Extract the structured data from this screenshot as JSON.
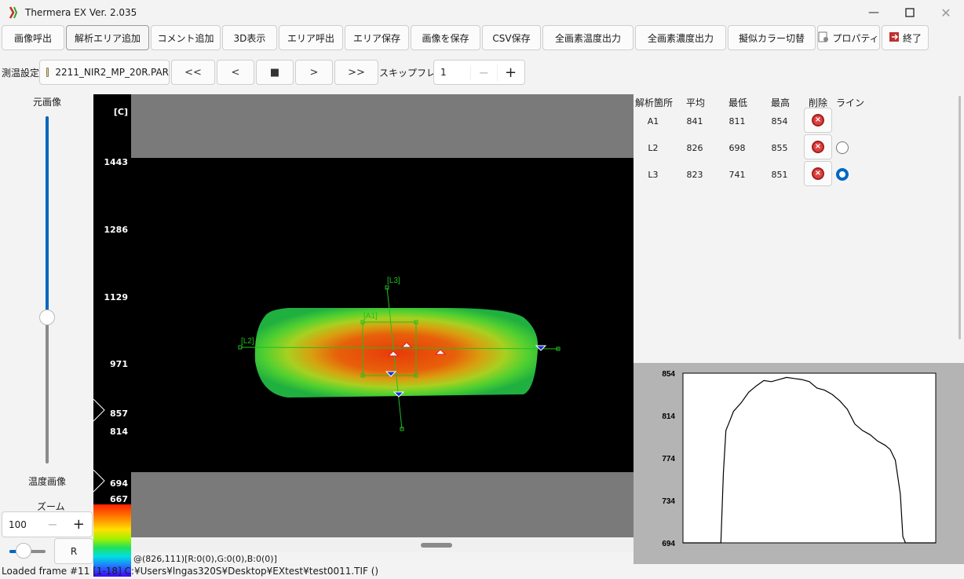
{
  "app": {
    "title": "Thermera EX Ver. 2.035"
  },
  "toolbar": {
    "buttons": [
      {
        "label": "画像呼出"
      },
      {
        "label": "解析エリア追加"
      },
      {
        "label": "コメント追加"
      },
      {
        "label": "3D表示"
      },
      {
        "label": "エリア呼出"
      },
      {
        "label": "エリア保存"
      },
      {
        "label": "画像を保存"
      },
      {
        "label": "CSV保存"
      },
      {
        "label": "全画素温度出力"
      },
      {
        "label": "全画素濃度出力"
      },
      {
        "label": "擬似カラー切替"
      },
      {
        "label": "プロパティ"
      },
      {
        "label": "終了"
      }
    ]
  },
  "measure": {
    "label": "測温設定",
    "file": "2211_NIR2_MP_20R.PAR",
    "nav": [
      "<<",
      "<",
      "■",
      ">",
      ">>"
    ],
    "skip_label": "スキップフレーム",
    "skip_value": "1",
    "minus": "−",
    "plus": "+"
  },
  "left": {
    "original_label": "元画像",
    "thermal_label": "温度画像",
    "original_vs_thermal_slider": 0.58,
    "zoom_label": "ズーム",
    "zoom_value": "100",
    "minus": "−",
    "plus": "+",
    "zoom_slider": 0.4,
    "r_label": "R"
  },
  "scale": {
    "header": "[C]",
    "ticks": [
      "1443",
      "1286",
      "1129",
      "971",
      "857",
      "814",
      "694",
      "667"
    ]
  },
  "image": {
    "areas": [
      "[L3]",
      "[A1]",
      "[L2]"
    ],
    "coord_readout": "@(826,111)[R:0(0),G:0(0),B:0(0)]"
  },
  "results": {
    "headers": [
      "解析箇所",
      "平均",
      "最低",
      "最高",
      "削除",
      "ライン"
    ],
    "rows": [
      {
        "name": "A1",
        "avg": "841",
        "min": "811",
        "max": "854",
        "line": null
      },
      {
        "name": "L2",
        "avg": "826",
        "min": "698",
        "max": "855",
        "line": false
      },
      {
        "name": "L3",
        "avg": "823",
        "min": "741",
        "max": "851",
        "line": true
      }
    ]
  },
  "chart_data": {
    "type": "line",
    "yticks": [
      "854",
      "814",
      "774",
      "734",
      "694"
    ],
    "ylim": [
      694,
      854
    ],
    "xlim": [
      0,
      100
    ],
    "x": [
      0,
      15,
      16,
      17,
      18,
      20,
      23,
      26,
      29,
      32,
      35,
      38,
      41,
      44,
      47,
      50,
      53,
      56,
      59,
      62,
      65,
      68,
      71,
      74,
      77,
      80,
      82,
      84,
      86,
      87,
      88,
      100
    ],
    "series": [
      {
        "values": [
          694,
          694,
          760,
          800,
          806,
          818,
          826,
          836,
          842,
          847,
          846,
          848,
          850,
          849,
          848,
          846,
          840,
          838,
          834,
          828,
          820,
          806,
          800,
          796,
          790,
          786,
          782,
          772,
          740,
          700,
          694,
          694
        ]
      }
    ]
  },
  "status": {
    "text": "Loaded frame #11 [1-18] C:¥Users¥lngas320S¥Desktop¥EXtest¥test0011.TIF ()"
  }
}
